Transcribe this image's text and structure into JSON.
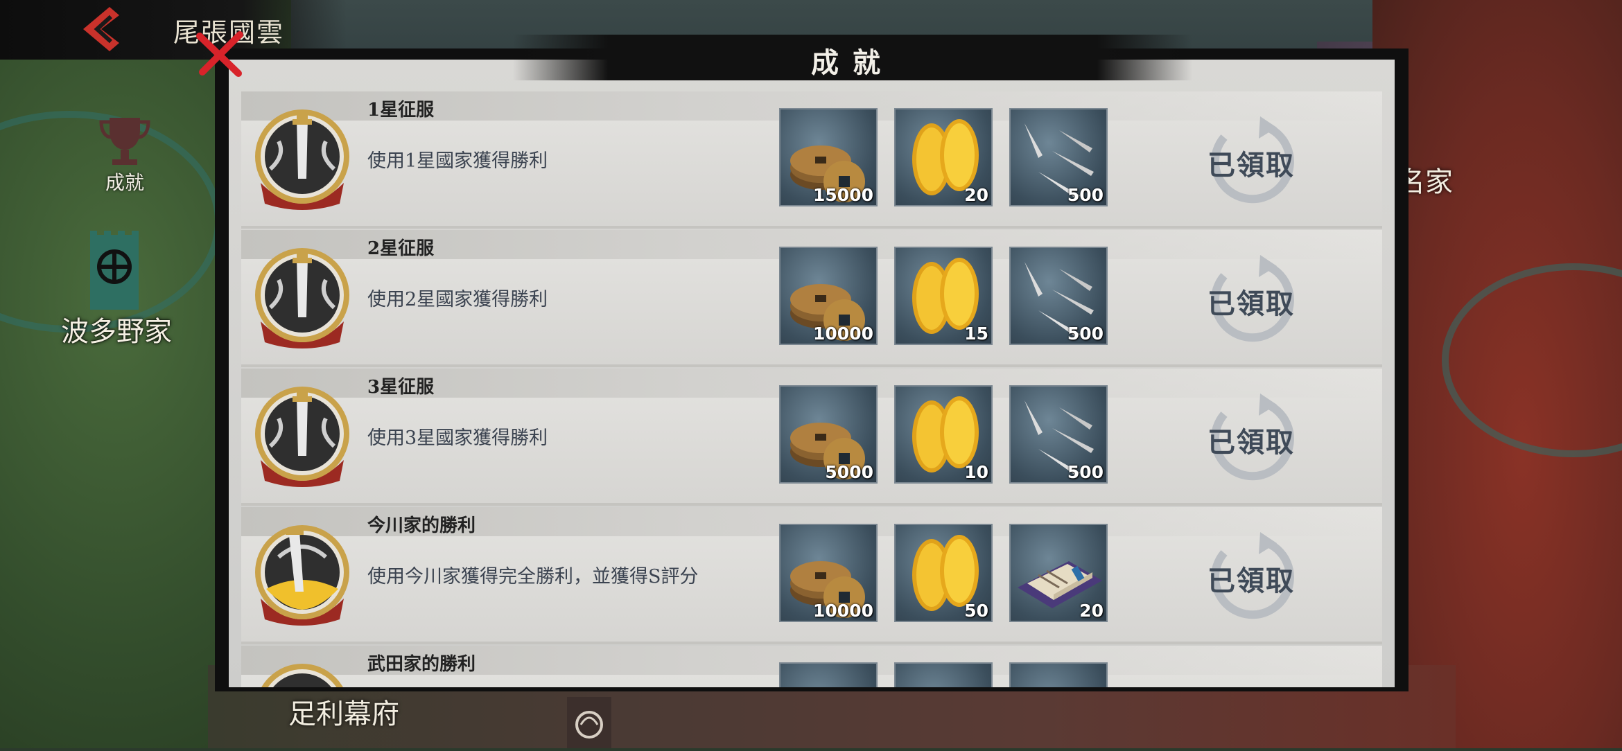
{
  "map": {
    "region_name": "尾張國雲",
    "achievement_label": "成就",
    "hatano_clan": "波多野家",
    "right_clan_partial": "名家",
    "ashikaga": "足利幕府"
  },
  "dialog": {
    "title": "成就",
    "claimed_label": "已領取",
    "achievements": [
      {
        "title": "1星征服",
        "description": "使用1星國家獲得勝利",
        "rewards": [
          {
            "icon": "copper-coins-icon",
            "qty": "15000"
          },
          {
            "icon": "gold-koban-icon",
            "qty": "20"
          },
          {
            "icon": "kunai-icon",
            "qty": "500"
          }
        ],
        "status": "已領取"
      },
      {
        "title": "2星征服",
        "description": "使用2星國家獲得勝利",
        "rewards": [
          {
            "icon": "copper-coins-icon",
            "qty": "10000"
          },
          {
            "icon": "gold-koban-icon",
            "qty": "15"
          },
          {
            "icon": "kunai-icon",
            "qty": "500"
          }
        ],
        "status": "已領取"
      },
      {
        "title": "3星征服",
        "description": "使用3星國家獲得勝利",
        "rewards": [
          {
            "icon": "copper-coins-icon",
            "qty": "5000"
          },
          {
            "icon": "gold-koban-icon",
            "qty": "10"
          },
          {
            "icon": "kunai-icon",
            "qty": "500"
          }
        ],
        "status": "已領取"
      },
      {
        "title": "今川家的勝利",
        "description": "使用今川家獲得完全勝利，並獲得S評分",
        "rewards": [
          {
            "icon": "copper-coins-icon",
            "qty": "10000"
          },
          {
            "icon": "gold-koban-icon",
            "qty": "50"
          },
          {
            "icon": "book-scroll-icon",
            "qty": "20"
          }
        ],
        "status": "已領取"
      },
      {
        "title": "武田家的勝利"
      }
    ]
  },
  "colors": {
    "panel": "#d9d8d5",
    "title_bar": "#111111",
    "claimed_text": "#3f4a58",
    "close_x": "#d8232a"
  }
}
